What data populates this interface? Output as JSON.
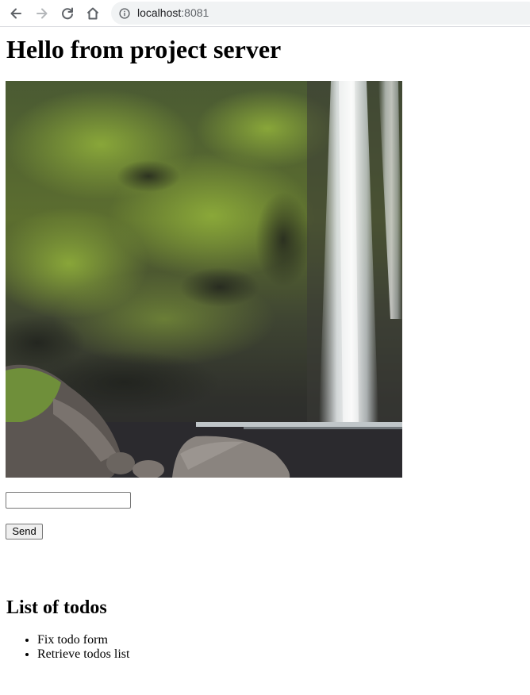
{
  "browser": {
    "url_host": "localhost",
    "url_port": ":8081",
    "icons": {
      "back": "arrow-left-icon",
      "forward": "arrow-right-icon",
      "reload": "reload-icon",
      "home": "home-icon",
      "site_info": "info-icon"
    }
  },
  "page": {
    "title": "Hello from project server",
    "image": {
      "subject": "waterfall-photo"
    },
    "form": {
      "input_value": "",
      "input_placeholder": "",
      "send_label": "Send"
    },
    "todos": {
      "heading": "List of todos",
      "items": [
        "Fix todo form",
        "Retrieve todos list"
      ]
    }
  }
}
